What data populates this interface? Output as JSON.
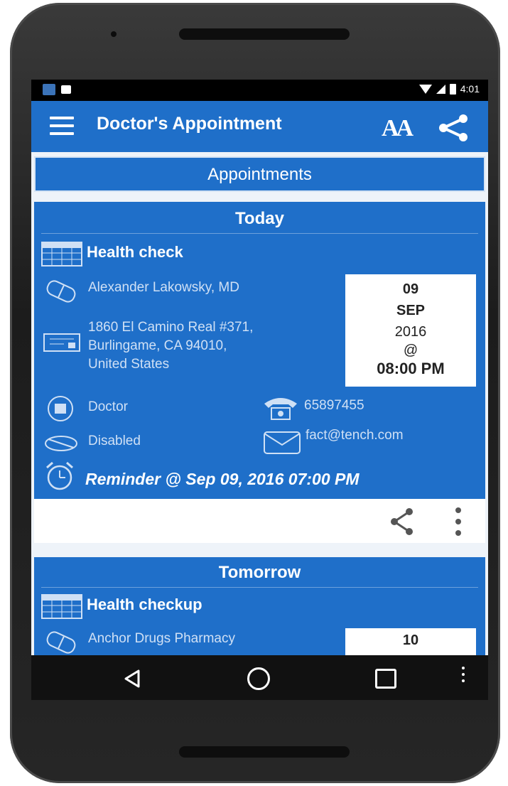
{
  "status_bar": {
    "time": "4:01"
  },
  "app_bar": {
    "title": "Doctor's Appointment",
    "font_size_icon": "AA"
  },
  "section": {
    "label": "Appointments"
  },
  "appointments": [
    {
      "day": "Today",
      "title": "Health check",
      "doctor": "Alexander Lakowsky, MD",
      "address_lines": [
        "1860 El Camino Real #371,",
        "Burlingame, CA 94010,",
        "United States"
      ],
      "date": {
        "day": "09",
        "month": "SEP",
        "year": "2016",
        "at": "@",
        "time": "08:00 PM"
      },
      "type": "Doctor",
      "phone": "65897455",
      "status": "Disabled",
      "email": "fact@tench.com",
      "reminder": "Reminder @ Sep 09, 2016 07:00 PM"
    },
    {
      "day": "Tomorrow",
      "title": "Health checkup",
      "doctor": "Anchor Drugs Pharmacy",
      "date": {
        "day": "10"
      }
    }
  ],
  "colors": {
    "app_blue": "#1f6fc9",
    "fab_pink": "#e6357f"
  }
}
